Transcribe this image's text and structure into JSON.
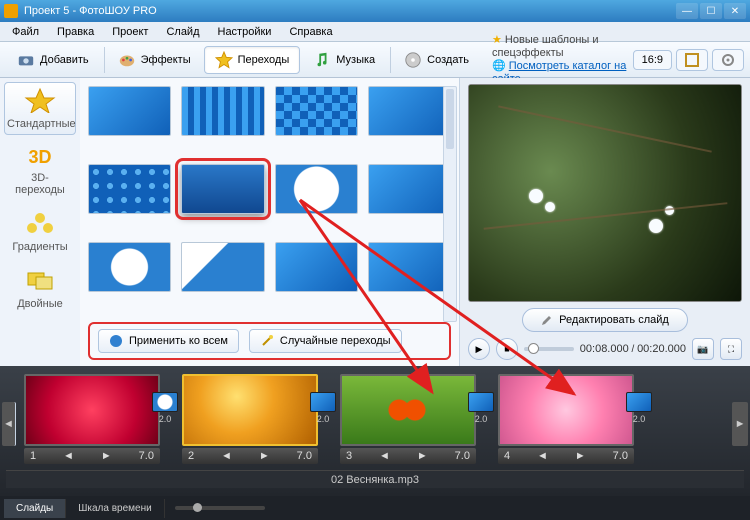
{
  "window": {
    "title": "Проект 5 - ФотоШОУ PRO"
  },
  "menu": [
    "Файл",
    "Правка",
    "Проект",
    "Слайд",
    "Настройки",
    "Справка"
  ],
  "toolbar": {
    "add": "Добавить",
    "effects": "Эффекты",
    "transitions": "Переходы",
    "music": "Музыка",
    "create": "Создать"
  },
  "news": {
    "line1": "Новые шаблоны и спецэффекты",
    "line2": "Посмотреть каталог на сайте..."
  },
  "ratio": "16:9",
  "side_tabs": {
    "standard": "Стандартные",
    "threeD": "3D-переходы",
    "gradients": "Градиенты",
    "double": "Двойные"
  },
  "apply": {
    "all": "Применить ко всем",
    "random": "Случайные переходы"
  },
  "preview": {
    "edit": "Редактировать слайд",
    "time_current": "00:08.000",
    "time_total": "00:20.000"
  },
  "clips": [
    {
      "n": "1",
      "dur": "7.0",
      "trans_dur": "2.0"
    },
    {
      "n": "2",
      "dur": "7.0",
      "trans_dur": "2.0"
    },
    {
      "n": "3",
      "dur": "7.0",
      "trans_dur": "2.0"
    },
    {
      "n": "4",
      "dur": "7.0",
      "trans_dur": "2.0"
    }
  ],
  "audio": "02 Веснянка.mp3",
  "bottom_tabs": {
    "slides": "Слайды",
    "timeline": "Шкала времени"
  }
}
